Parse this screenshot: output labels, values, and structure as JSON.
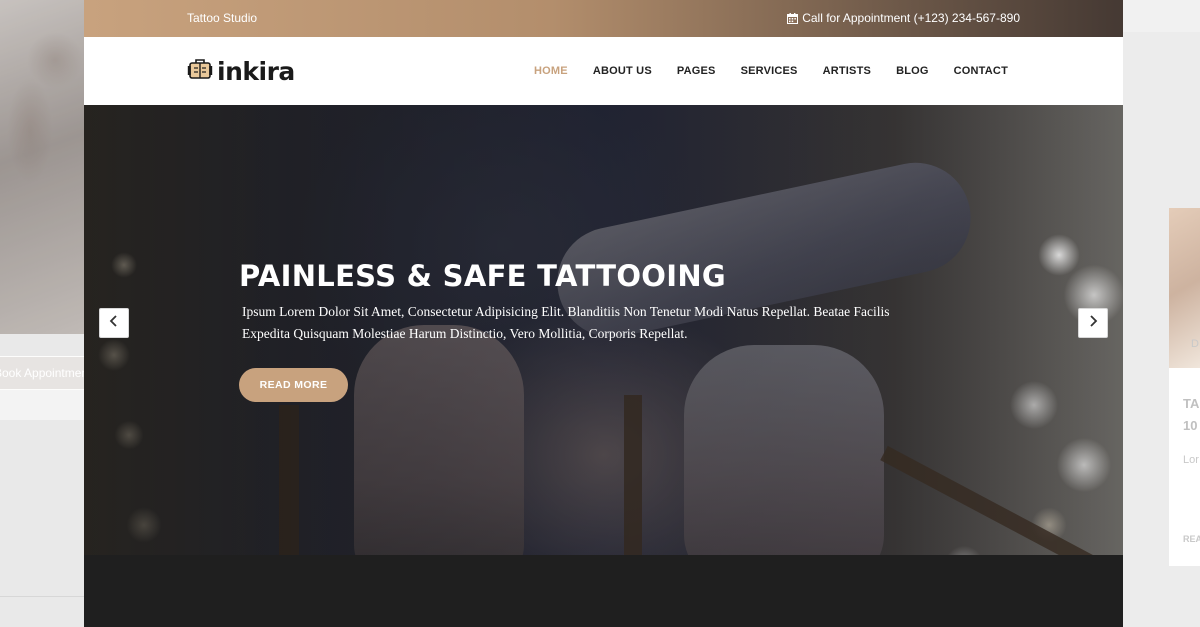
{
  "left_preview": {
    "button_label": "Book Appointment"
  },
  "right_preview": {
    "heading_1": "TA",
    "heading_2": "10",
    "text": "Lor",
    "link": "REA",
    "badge": "D"
  },
  "topbar": {
    "studio": "Tattoo Studio",
    "contact": "Call for Appointment (+123) 234-567-890",
    "contact_icon": "calendar-icon"
  },
  "logo": {
    "text": "inkira",
    "icon": "tattoo-machine-icon"
  },
  "nav": {
    "items": [
      {
        "label": "HOME",
        "active": true
      },
      {
        "label": "ABOUT US",
        "active": false
      },
      {
        "label": "PAGES",
        "active": false
      },
      {
        "label": "SERVICES",
        "active": false
      },
      {
        "label": "ARTISTS",
        "active": false
      },
      {
        "label": "BLOG",
        "active": false
      },
      {
        "label": "CONTACT",
        "active": false
      }
    ]
  },
  "hero": {
    "title": "PAINLESS & SAFE TATTOOING",
    "text": "Ipsum Lorem Dolor Sit Amet, Consectetur Adipisicing Elit. Blanditiis Non Tenetur Modi Natus Repellat. Beatae Facilis Expedita Quisquam Molestiae Harum Distinctio, Vero Mollitia, Corporis Repellat.",
    "button_label": "READ MORE",
    "prev_icon": "chevron-left-icon",
    "next_icon": "chevron-right-icon"
  },
  "colors": {
    "accent": "#c8a27e",
    "topbar_dark": "#453933",
    "nav_text": "#222222"
  }
}
